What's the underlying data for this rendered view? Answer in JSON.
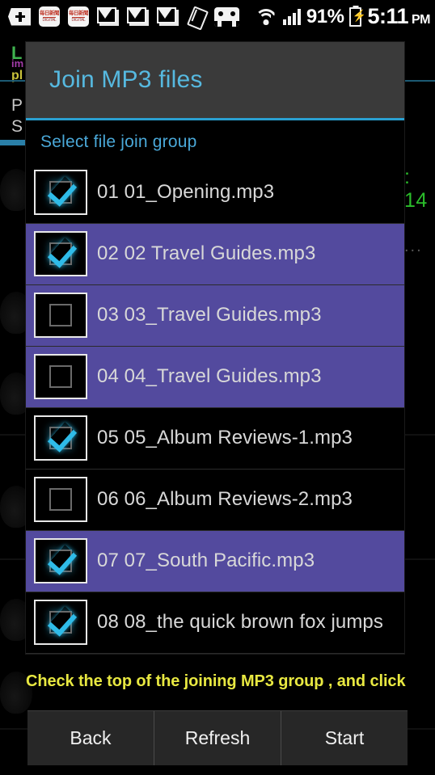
{
  "status_bar": {
    "icons": [
      {
        "name": "plus-badge-icon",
        "label": "+"
      },
      {
        "name": "news-app-icon",
        "line1": "毎日新聞",
        "line2": "DIGITAL"
      },
      {
        "name": "news-app-icon",
        "line1": "毎日新聞",
        "line2": "DIGITAL"
      },
      {
        "name": "gmail-icon",
        "label": "M"
      },
      {
        "name": "gmail-icon",
        "label": "M"
      },
      {
        "name": "gmail-icon",
        "label": "M"
      },
      {
        "name": "card-tilt-icon",
        "label": ""
      },
      {
        "name": "robot-face-icon",
        "label": ""
      }
    ],
    "wifi": "wifi-icon",
    "signal": "cellular-signal-icon",
    "battery_percent": "91%",
    "battery_icon": "battery-charging-icon",
    "time": "5:11",
    "ampm": "PM"
  },
  "background_app": {
    "title_line1": "L",
    "title_line2": "im",
    "title_line3": "pl",
    "label_p": "P",
    "label_s": "S",
    "green_time": ": 14",
    "overflow_dots": "..."
  },
  "dialog": {
    "title": "Join MP3 files",
    "subtitle": "Select file join group",
    "hint": "Check the top of the joining MP3 group , and click",
    "accent_color": "#2a9fd0",
    "title_color": "#56b9e0",
    "subtitle_color": "#4aa8d8",
    "highlight_color": "#534a9e",
    "hint_color": "#e8e841",
    "header_bg": "#3a3a3a",
    "check_color": "#2fbbe8",
    "files": [
      {
        "name": "01 01_Opening.mp3",
        "checked": true,
        "selected": false
      },
      {
        "name": "02 02 Travel Guides.mp3",
        "checked": true,
        "selected": true
      },
      {
        "name": "03 03_Travel Guides.mp3",
        "checked": false,
        "selected": true
      },
      {
        "name": "04 04_Travel Guides.mp3",
        "checked": false,
        "selected": true
      },
      {
        "name": "05 05_Album Reviews-1.mp3",
        "checked": true,
        "selected": false
      },
      {
        "name": "06 06_Album Reviews-2.mp3",
        "checked": false,
        "selected": false
      },
      {
        "name": "07 07_South Pacific.mp3",
        "checked": true,
        "selected": true
      },
      {
        "name": "08 08_the quick brown fox jumps",
        "checked": true,
        "selected": false
      },
      {
        "name": "",
        "checked": false,
        "selected": true
      }
    ],
    "buttons": [
      {
        "label": "Back",
        "name": "back-button"
      },
      {
        "label": "Refresh",
        "name": "refresh-button"
      },
      {
        "label": "Start",
        "name": "start-button"
      }
    ]
  }
}
